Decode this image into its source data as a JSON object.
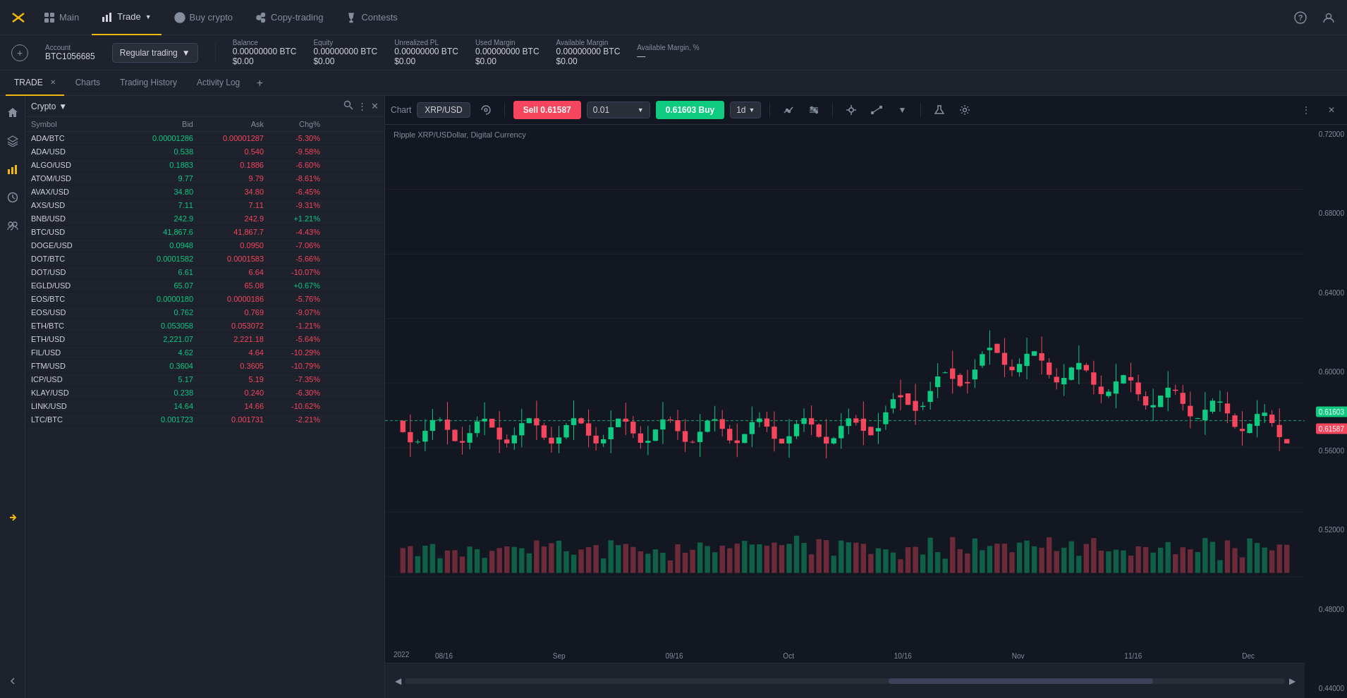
{
  "nav": {
    "logo": "✕",
    "items": [
      {
        "label": "Main",
        "icon": "grid",
        "active": false
      },
      {
        "label": "Trade",
        "icon": "bar-chart",
        "active": true,
        "hasArrow": true
      },
      {
        "label": "Buy crypto",
        "icon": "arrow-circle",
        "active": false
      },
      {
        "label": "Copy-trading",
        "icon": "copy",
        "active": false
      },
      {
        "label": "Contests",
        "icon": "trophy",
        "active": false
      }
    ],
    "help_icon": "?",
    "user_icon": "person"
  },
  "account_bar": {
    "account_label": "Account",
    "account_id": "BTC1056685",
    "trading_type": "Regular trading",
    "balance_label": "Balance",
    "balance_btc": "0.00000000 BTC",
    "balance_usd": "$0.00",
    "equity_label": "Equity",
    "equity_btc": "0.00000000 BTC",
    "equity_usd": "$0.00",
    "unrealized_pl_label": "Unrealized PL",
    "unrealized_pl_btc": "0.00000000 BTC",
    "unrealized_pl_usd": "$0.00",
    "used_margin_label": "Used Margin",
    "used_margin_btc": "0.00000000 BTC",
    "used_margin_usd": "$0.00",
    "available_margin_label": "Available Margin",
    "available_margin_btc": "0.00000000 BTC",
    "available_margin_usd": "$0.00",
    "available_margin_pct_label": "Available Margin, %",
    "available_margin_pct": "—"
  },
  "tabs": [
    {
      "label": "TRADE",
      "active": true,
      "closeable": true
    },
    {
      "label": "Charts",
      "active": false
    },
    {
      "label": "Trading History",
      "active": false
    },
    {
      "label": "Activity Log",
      "active": false
    }
  ],
  "crypto_panel": {
    "label": "Crypto",
    "columns": [
      "Symbol",
      "Bid",
      "Ask",
      "Chg%"
    ],
    "rows": [
      {
        "symbol": "ADA/BTC",
        "bid": "0.00001286",
        "ask": "0.00001287",
        "chg": "-5.30%",
        "chg_pos": false
      },
      {
        "symbol": "ADA/USD",
        "bid": "0.538",
        "ask": "0.540",
        "chg": "-9.58%",
        "chg_pos": false
      },
      {
        "symbol": "ALGO/USD",
        "bid": "0.1883",
        "ask": "0.1886",
        "chg": "-6.60%",
        "chg_pos": false
      },
      {
        "symbol": "ATOM/USD",
        "bid": "9.77",
        "ask": "9.79",
        "chg": "-8.61%",
        "chg_pos": false
      },
      {
        "symbol": "AVAX/USD",
        "bid": "34.80",
        "ask": "34.80",
        "chg": "-6.45%",
        "chg_pos": false
      },
      {
        "symbol": "AXS/USD",
        "bid": "7.11",
        "ask": "7.11",
        "chg": "-9.31%",
        "chg_pos": false
      },
      {
        "symbol": "BNB/USD",
        "bid": "242.9",
        "ask": "242.9",
        "chg": "+1.21%",
        "chg_pos": true
      },
      {
        "symbol": "BTC/USD",
        "bid": "41,867.6",
        "ask": "41,867.7",
        "chg": "-4.43%",
        "chg_pos": false
      },
      {
        "symbol": "DOGE/USD",
        "bid": "0.0948",
        "ask": "0.0950",
        "chg": "-7.06%",
        "chg_pos": false
      },
      {
        "symbol": "DOT/BTC",
        "bid": "0.0001582",
        "ask": "0.0001583",
        "chg": "-5.66%",
        "chg_pos": false
      },
      {
        "symbol": "DOT/USD",
        "bid": "6.61",
        "ask": "6.64",
        "chg": "-10.07%",
        "chg_pos": false
      },
      {
        "symbol": "EGLD/USD",
        "bid": "65.07",
        "ask": "65.08",
        "chg": "+0.67%",
        "chg_pos": true
      },
      {
        "symbol": "EOS/BTC",
        "bid": "0.0000180",
        "ask": "0.0000186",
        "chg": "-5.76%",
        "chg_pos": false
      },
      {
        "symbol": "EOS/USD",
        "bid": "0.762",
        "ask": "0.769",
        "chg": "-9.07%",
        "chg_pos": false
      },
      {
        "symbol": "ETH/BTC",
        "bid": "0.053058",
        "ask": "0.053072",
        "chg": "-1.21%",
        "chg_pos": false
      },
      {
        "symbol": "ETH/USD",
        "bid": "2,221.07",
        "ask": "2,221.18",
        "chg": "-5.64%",
        "chg_pos": false
      },
      {
        "symbol": "FIL/USD",
        "bid": "4.62",
        "ask": "4.64",
        "chg": "-10.29%",
        "chg_pos": false
      },
      {
        "symbol": "FTM/USD",
        "bid": "0.3604",
        "ask": "0.3605",
        "chg": "-10.79%",
        "chg_pos": false
      },
      {
        "symbol": "ICP/USD",
        "bid": "5.17",
        "ask": "5.19",
        "chg": "-7.35%",
        "chg_pos": false
      },
      {
        "symbol": "KLAY/USD",
        "bid": "0.238",
        "ask": "0.240",
        "chg": "-6.30%",
        "chg_pos": false
      },
      {
        "symbol": "LINK/USD",
        "bid": "14.64",
        "ask": "14.66",
        "chg": "-10.62%",
        "chg_pos": false
      },
      {
        "symbol": "LTC/BTC",
        "bid": "0.001723",
        "ask": "0.001731",
        "chg": "-2.21%",
        "chg_pos": false
      }
    ]
  },
  "chart": {
    "label": "Chart",
    "symbol": "XRP/USD",
    "subtitle": "Ripple XRP/USDollar, Digital Currency",
    "sell_label": "Sell 0.61587",
    "price_input": "0.01",
    "buy_price": "0.61603",
    "buy_label": "Buy",
    "timeframe": "1d",
    "price_levels": [
      "0.72000",
      "0.68000",
      "0.64000",
      "0.60000",
      "0.56000",
      "0.52000",
      "0.48000",
      "0.44000"
    ],
    "current_price": "0.61603",
    "current_price2": "0.61587",
    "time_labels": [
      "08/16",
      "Sep",
      "09/16",
      "Oct",
      "10/16",
      "Nov",
      "11/16",
      "Dec"
    ],
    "year_label": "2022",
    "toolbar_icons": [
      "indicator",
      "line-tool",
      "circle-tool",
      "draw-tool",
      "arrow-tool",
      "flask-icon",
      "gear-icon"
    ]
  }
}
